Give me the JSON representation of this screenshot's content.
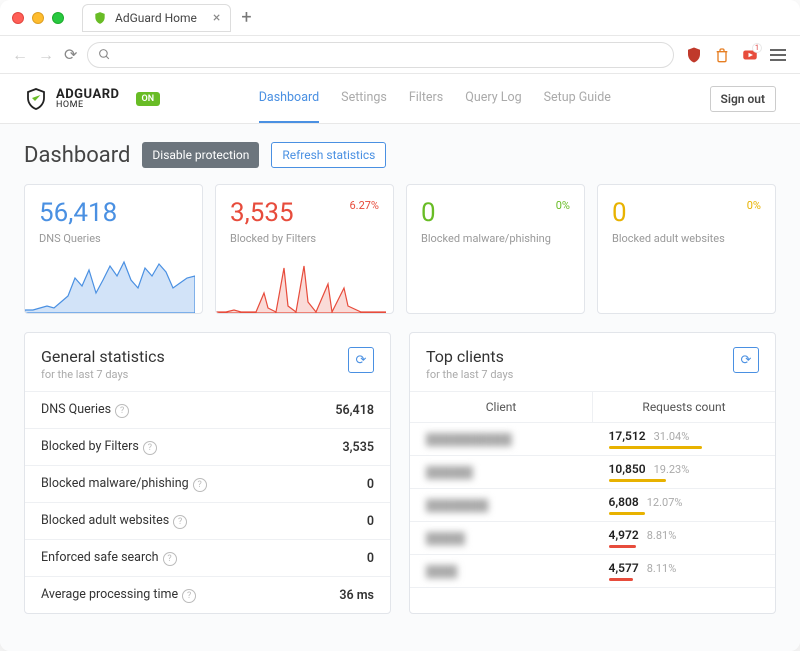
{
  "browser": {
    "tab_title": "AdGuard Home",
    "ext_badge": "1"
  },
  "app": {
    "brand_main": "ADGUARD",
    "brand_sub": "HOME",
    "on_badge": "ON",
    "nav": {
      "dashboard": "Dashboard",
      "settings": "Settings",
      "filters": "Filters",
      "querylog": "Query Log",
      "setup": "Setup Guide"
    },
    "signout": "Sign out"
  },
  "page": {
    "title": "Dashboard",
    "disable_btn": "Disable protection",
    "refresh_btn": "Refresh statistics"
  },
  "stats": {
    "dns": {
      "value": "56,418",
      "label": "DNS Queries"
    },
    "blocked": {
      "value": "3,535",
      "label": "Blocked by Filters",
      "pct": "6.27%"
    },
    "malware": {
      "value": "0",
      "label": "Blocked malware/phishing",
      "pct": "0%"
    },
    "adult": {
      "value": "0",
      "label": "Blocked adult websites",
      "pct": "0%"
    }
  },
  "general": {
    "title": "General statistics",
    "sub": "for the last 7 days",
    "rows": {
      "dns": {
        "label": "DNS Queries",
        "value": "56,418"
      },
      "blocked": {
        "label": "Blocked by Filters",
        "value": "3,535"
      },
      "malware": {
        "label": "Blocked malware/phishing",
        "value": "0"
      },
      "adult": {
        "label": "Blocked adult websites",
        "value": "0"
      },
      "safe": {
        "label": "Enforced safe search",
        "value": "0"
      },
      "avg": {
        "label": "Average processing time",
        "value": "36 ms"
      }
    }
  },
  "clients": {
    "title": "Top clients",
    "sub": "for the last 7 days",
    "col1": "Client",
    "col2": "Requests count",
    "rows": [
      {
        "name": "███████████",
        "count": "17,512",
        "pct": "31.04%",
        "bar_pct": 62,
        "bar_color": "gold"
      },
      {
        "name": "██████",
        "count": "10,850",
        "pct": "19.23%",
        "bar_pct": 38,
        "bar_color": "gold"
      },
      {
        "name": "████████",
        "count": "6,808",
        "pct": "12.07%",
        "bar_pct": 24,
        "bar_color": "gold"
      },
      {
        "name": "█████",
        "count": "4,972",
        "pct": "8.81%",
        "bar_pct": 18,
        "bar_color": "red"
      },
      {
        "name": "████",
        "count": "4,577",
        "pct": "8.11%",
        "bar_pct": 16,
        "bar_color": "red"
      }
    ]
  },
  "chart_data": [
    {
      "type": "line",
      "series_name": "DNS Queries",
      "color": "#4a90e2",
      "title": "DNS Queries last 7 days",
      "values": [
        0,
        0,
        2,
        3,
        1,
        2,
        1,
        4,
        8,
        25,
        18,
        30,
        12,
        22,
        28,
        35,
        20,
        15,
        30,
        25,
        32,
        28,
        18,
        20
      ]
    },
    {
      "type": "line",
      "series_name": "Blocked by Filters",
      "color": "#e74c3c",
      "title": "Blocked by Filters last 7 days",
      "values": [
        0,
        0,
        1,
        0,
        0,
        0,
        0,
        0,
        12,
        4,
        0,
        28,
        2,
        0,
        30,
        5,
        0,
        0,
        14,
        0,
        10,
        2,
        0,
        0
      ]
    }
  ]
}
